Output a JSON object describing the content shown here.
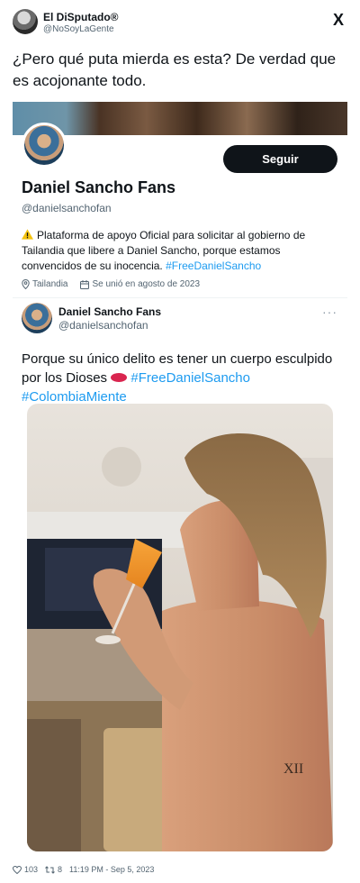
{
  "tweet": {
    "author_name": "El DiSputado®",
    "author_handle": "@NoSoyLaGente",
    "logo": "X",
    "text": "¿Pero qué puta mierda es esta? De verdad que es acojonante todo."
  },
  "profile": {
    "follow_label": "Seguir",
    "name": "Daniel Sancho Fans",
    "handle": "@danielsanchofan",
    "bio_text": "Plataforma de apoyo Oficial para solicitar al gobierno de Tailandia que libere a Daniel Sancho, porque estamos convencidos de su inocencia. ",
    "bio_hashtag": "#FreeDanielSancho",
    "location": "Tailandia",
    "joined": "Se unió en agosto de 2023"
  },
  "inner_tweet": {
    "name": "Daniel Sancho Fans",
    "handle": "@danielsanchofan",
    "more": "···",
    "text": "Porque su único delito es tener un cuerpo esculpido por los Dioses ",
    "hashtag1": "#FreeDanielSancho",
    "hashtag2": "#ColombiaMiente"
  },
  "footer": {
    "likes": "103",
    "retweets": "8",
    "timestamp": "11:19 PM - Sep 5, 2023"
  },
  "colors": {
    "link": "#1d9bf0",
    "text": "#0f1419",
    "secondary": "#536471",
    "button": "#0f1419"
  },
  "icons": [
    "warning-icon",
    "location-icon",
    "calendar-icon",
    "more-icon",
    "heart-icon",
    "retweet-icon",
    "x-logo-icon"
  ]
}
